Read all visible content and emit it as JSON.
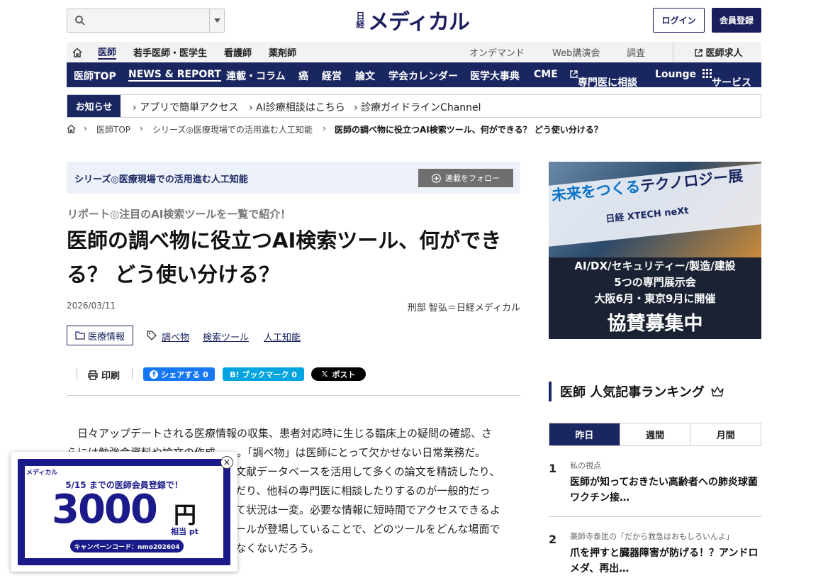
{
  "header": {
    "logo_small": "日経",
    "logo_main": "メディカル",
    "login_label": "ログイン",
    "register_label": "会員登録",
    "search_placeholder": ""
  },
  "nav_top": {
    "items": [
      "医師",
      "若手医師・医学生",
      "看護師",
      "薬剤師"
    ],
    "right_items": [
      "オンデマンド",
      "Web講演会",
      "調査"
    ],
    "jobs_label": "医師求人"
  },
  "nav_main": {
    "items": [
      "医師TOP",
      "NEWS & REPORT",
      "連載・コラム",
      "癌",
      "経営",
      "論文",
      "学会カレンダー",
      "医学大事典",
      "CME",
      "専門医に相談",
      "Lounge",
      "サービス"
    ]
  },
  "notice": {
    "label": "お知らせ",
    "links": [
      "アプリで簡単アクセス",
      "AI診療相談はこちら",
      "診療ガイドラインChannel"
    ]
  },
  "breadcrumb": [
    "医師TOP",
    "シリーズ◎医療現場での活用進む人工知能",
    "医師の調べ物に役立つAI検索ツール、何ができる？ どう使い分ける？"
  ],
  "series": {
    "title": "シリーズ◎医療現場での活用進む人工知能",
    "follow_label": "連載をフォロー"
  },
  "article": {
    "kicker": "リポート◎注目のAI検索ツールを一覧で紹介！",
    "title": "医師の調べ物に役立つAI検索ツール、何ができる？ どう使い分ける？",
    "date": "2026/03/11",
    "author": "刑部 智弘＝日経メディカル",
    "category": "医療情報",
    "tags": [
      "調べ物",
      "検索ツール",
      "人工知能"
    ],
    "print_label": "印刷",
    "fb_label": "シェアする 0",
    "hatena_label": "B! ブックマーク 0",
    "x_label": "ポスト",
    "body_lines": [
      "日々アップデートされる医療情報の収集、患者対応時に生じる臨床上の疑問の確認、さ",
      "らには勉強会資料や論文の作成――。「調べ物」は医師にとって欠かせない日常業務だ。",
      "文献データベースを活用して多くの論文を精読したり、",
      "だり、他科の専門医に相談したりするのが一般的だっ",
      "て状況は一変。必要な情報に短時間でアクセスできるよ",
      "ールが登場していることで、どのツールをどんな場面で",
      "なくないだろう。"
    ]
  },
  "ad": {
    "headline_a": "未来をつくる",
    "headline_b": "テクノロジー展",
    "brand": "日経 XTECH neXt",
    "line1": "AI/DX/セキュリティー/製造/建設",
    "line2": "5つの専門展示会",
    "line3": "大阪6月・東京9月に開催",
    "line4": "協賛募集中"
  },
  "ranking": {
    "title": "医師 人気記事ランキング",
    "tabs": [
      "昨日",
      "週間",
      "月間"
    ],
    "items": [
      {
        "rank": "1",
        "category": "私の視点",
        "title": "医師が知っておきたい高齢者への肺炎球菌ワクチン接…"
      },
      {
        "rank": "2",
        "category": "薬師寺泰匡の「だから救急はおもしろいんよ」",
        "title": "爪を押すと臓器障害が防げる！？アンドロメダ、再出…"
      }
    ]
  },
  "popup": {
    "logo": "メディカル",
    "deadline": "5/15 までの医師会員登録で！",
    "amount": "3000",
    "unit": "円",
    "unit_sub": "相当 pt",
    "code": "キャンペーンコード：nmo202604",
    "close": "×"
  },
  "colors": {
    "navy": "#1a2660",
    "facebook": "#1877f2",
    "hatena": "#00a4de",
    "x": "#000000"
  }
}
